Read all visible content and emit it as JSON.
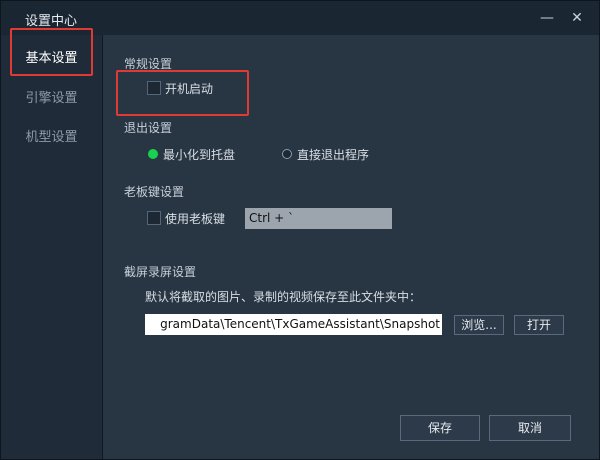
{
  "window": {
    "title": "设置中心",
    "minimize_label": "—",
    "close_label": "✕"
  },
  "sidebar": {
    "items": [
      {
        "label": "基本设置",
        "active": true
      },
      {
        "label": "引擎设置",
        "active": false
      },
      {
        "label": "机型设置",
        "active": false
      }
    ]
  },
  "general": {
    "title": "常规设置",
    "boot_start": {
      "label": "开机启动",
      "checked": false
    }
  },
  "exit": {
    "title": "退出设置",
    "options": [
      {
        "label": "最小化到托盘",
        "selected": true
      },
      {
        "label": "直接退出程序",
        "selected": false
      }
    ]
  },
  "boss_key": {
    "title": "老板键设置",
    "checkbox": {
      "label": "使用老板键",
      "checked": false
    },
    "hotkey_value": "Ctrl + `"
  },
  "screenshot": {
    "title": "截屏录屏设置",
    "description": "默认将截取的图片、录制的视频保存至此文件夹中：",
    "path_value": "gramData\\Tencent\\TxGameAssistant\\Snapshot",
    "browse_label": "浏览...",
    "open_label": "打开"
  },
  "footer": {
    "save_label": "保存",
    "cancel_label": "取消"
  },
  "colors": {
    "highlight_box": "#e03a35",
    "radio_selected": "#17d14f",
    "panel_bg": "#283543",
    "titlebar_bg": "#1b2633"
  }
}
